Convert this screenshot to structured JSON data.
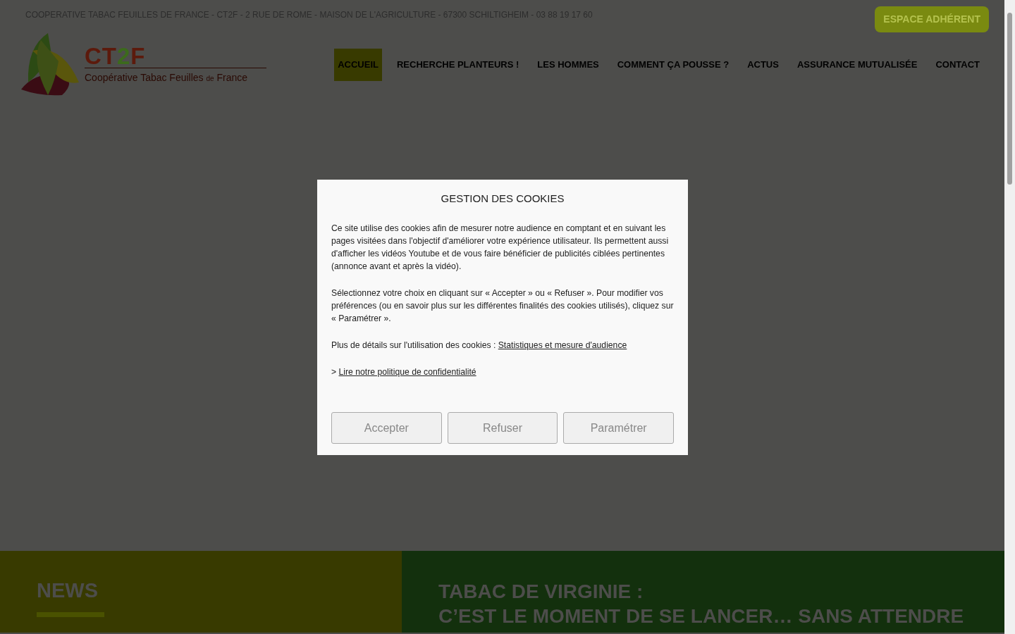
{
  "top_bar": {
    "address": "COOPERATIVE TABAC FEUILLES DE FRANCE - CT2F - 2 RUE DE ROME - MAISON DE L'AGRICULTURE - 67300 SCHILTIGHEIM - 03 88 19 17 60",
    "member_button": "ESPACE ADHÉRENT"
  },
  "logo": {
    "title_segments": [
      {
        "text": "CT",
        "color": "#5c1a0c"
      },
      {
        "text": "2",
        "color": "#3c6a1c"
      },
      {
        "text": "F",
        "color": "#5c1a0c"
      }
    ],
    "subtitle_segments": [
      {
        "text": "Coopérative Tabac Feuilles ",
        "small": false
      },
      {
        "text": "de",
        "small": true
      },
      {
        "text": " France",
        "small": false
      }
    ]
  },
  "nav": [
    {
      "label": "ACCUEIL",
      "selected": true
    },
    {
      "label": "RECHERCHE PLANTEURS !",
      "selected": false
    },
    {
      "label": "LES HOMMES",
      "selected": false
    },
    {
      "label": "COMMENT ÇA POUSSE ?",
      "selected": false
    },
    {
      "label": "ACTUS",
      "selected": false
    },
    {
      "label": "ASSURANCE MUTUALISÉE",
      "selected": false
    },
    {
      "label": "CONTACT",
      "selected": false
    }
  ],
  "news": {
    "title": "NEWS",
    "headline_lines": [
      "TABAC DE VIRGINIE :",
      "C’EST LE MOMENT DE SE LANCER… SANS ATTENDRE"
    ]
  },
  "cookie_dialog": {
    "title": "GESTION DES COOKIES",
    "paragraphs": [
      "Ce site utilise des cookies afin de mesurer notre audience en comptant et en suivant les pages visitées dans l'objectif d'améliorer votre expérience utilisateur. Ils permettent aussi d'afficher les vidéos Youtube et de vous faire bénéficier de publicités ciblées pertinentes (annonce avant et après la vidéo).",
      "Sélectionnez votre choix en cliquant sur « Accepter » ou « Refuser ». Pour modifier vos préférences (ou en savoir plus sur les différentes finalités des cookies utilisés), cliquez sur « Paramétrer »."
    ],
    "details": {
      "text": "Plus de détails sur l'utilisation des cookies :",
      "link": "Statistiques et mesure d'audience"
    },
    "policy": {
      "prefix": ">",
      "link": "Lire notre politique de confidentialité"
    },
    "buttons": [
      "Accepter",
      "Refuser",
      "Paramétrer"
    ]
  }
}
